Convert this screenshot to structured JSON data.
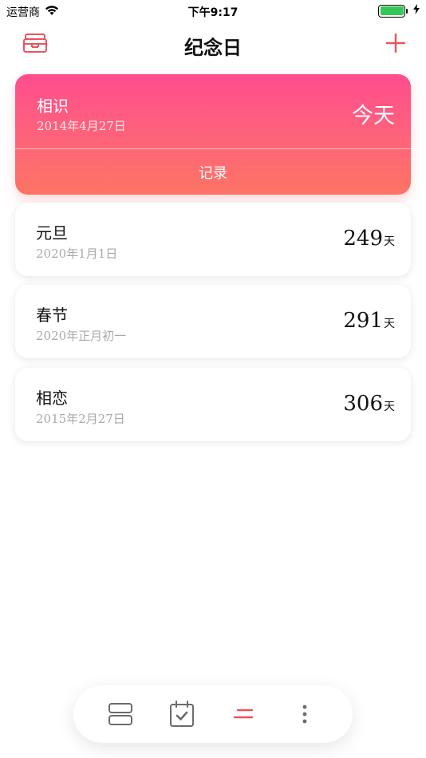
{
  "status_bar": {
    "carrier": "运营商",
    "time": "下午9:17",
    "battery_level": 1.0
  },
  "nav": {
    "title": "纪念日",
    "left_icon": "archive-box-icon",
    "right_icon": "plus-icon"
  },
  "featured": {
    "title": "相识",
    "date": "2014年4月27日",
    "value": "今天",
    "record_label": "记录"
  },
  "events": [
    {
      "title": "元旦",
      "date": "2020年1月1日",
      "value": "249",
      "unit": "天"
    },
    {
      "title": "春节",
      "date": "2020年正月初一",
      "value": "291",
      "unit": "天"
    },
    {
      "title": "相恋",
      "date": "2015年2月27日",
      "value": "306",
      "unit": "天"
    }
  ],
  "tab_bar": {
    "items": [
      "list-view-icon",
      "calendar-check-icon",
      "sort-icon",
      "more-vertical-icon"
    ],
    "active_index": 2
  },
  "colors": {
    "accent": "#f0505e",
    "card_gradient_top": "#ff4d8e",
    "card_gradient_bottom": "#fd7465",
    "battery": "#36c759"
  }
}
